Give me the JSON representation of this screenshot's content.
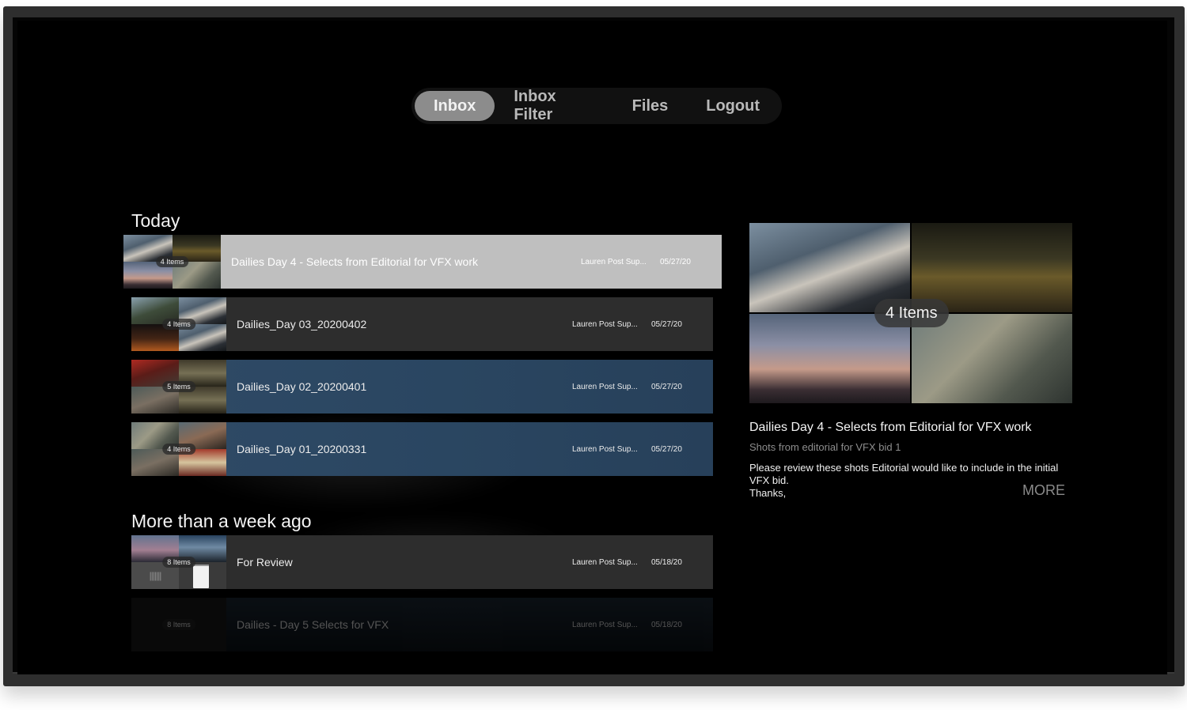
{
  "nav": {
    "tabs": [
      {
        "label": "Inbox",
        "active": true
      },
      {
        "label": "Inbox Filter",
        "active": false
      },
      {
        "label": "Files",
        "active": false
      },
      {
        "label": "Logout",
        "active": false
      }
    ]
  },
  "sections": {
    "today": "Today",
    "older": "More than a week ago"
  },
  "rows": [
    {
      "count": "4 Items",
      "title": "Dailies Day 4 - Selects from Editorial for VFX work",
      "owner": "Lauren Post Sup...",
      "date": "05/27/20",
      "state": "selected"
    },
    {
      "count": "4 Items",
      "title": "Dailies_Day 03_20200402",
      "owner": "Lauren Post Sup...",
      "date": "05/27/20",
      "state": "normal"
    },
    {
      "count": "5 Items",
      "title": "Dailies_Day 02_20200401",
      "owner": "Lauren Post Sup...",
      "date": "05/27/20",
      "state": "blue"
    },
    {
      "count": "4 Items",
      "title": "Dailies_Day 01_20200331",
      "owner": "Lauren Post Sup...",
      "date": "05/27/20",
      "state": "blue"
    },
    {
      "count": "8 Items",
      "title": "For Review",
      "owner": "Lauren Post Sup...",
      "date": "05/18/20",
      "state": "normal"
    },
    {
      "count": "8 Items",
      "title": "Dailies - Day 5 Selects for VFX",
      "owner": "Lauren Post Sup...",
      "date": "05/18/20",
      "state": "faded"
    }
  ],
  "detail": {
    "count": "4 Items",
    "title": "Dailies Day 4 - Selects from Editorial for VFX work",
    "subtitle": "Shots from editorial for VFX bid 1",
    "body_line1": "Please review these shots Editorial would like to include in the initial VFX bid.",
    "body_line2": "Thanks,",
    "more": "MORE"
  },
  "colors": {
    "selected_row": "#bfbfbf",
    "blue_row": "#2f4a66",
    "dark_row": "#2d2d2d",
    "nav_active": "#8c8c8c"
  }
}
